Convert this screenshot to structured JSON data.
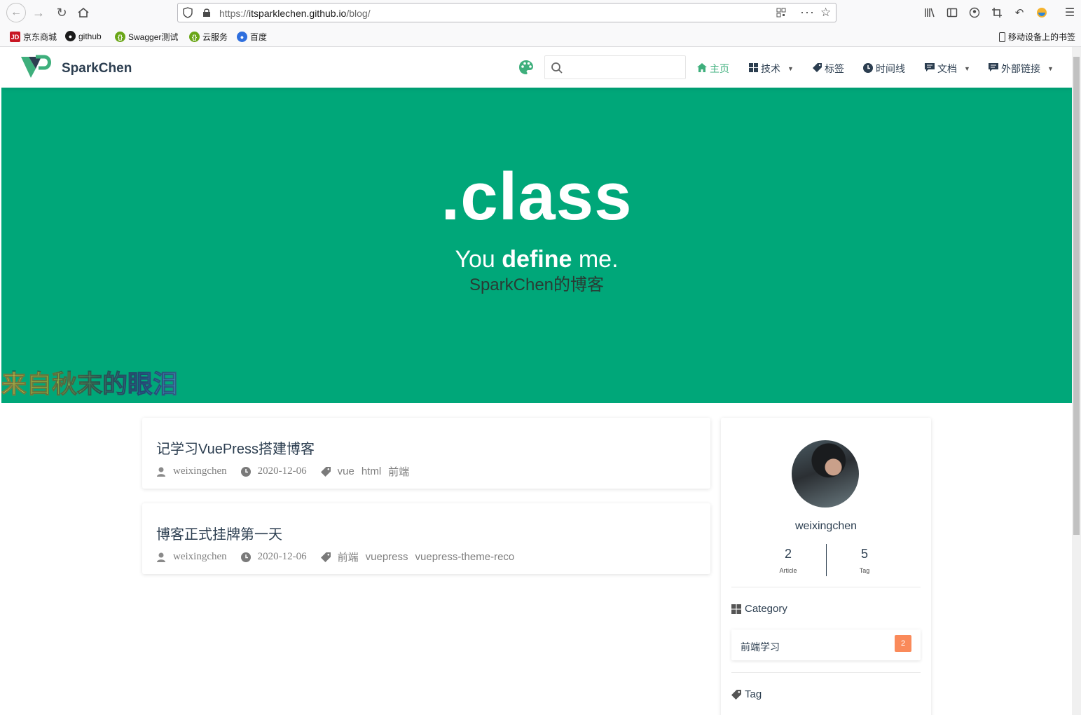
{
  "browser": {
    "url_prefix": "https://",
    "url_host": "itsparklechen.github.io",
    "url_path": "/blog/",
    "bookmarks": [
      {
        "label": "京东商城",
        "icon": "jd-icon",
        "color": "#c81623"
      },
      {
        "label": "github",
        "icon": "github-icon",
        "color": "#1b1b1b"
      },
      {
        "label": "Swagger测试",
        "icon": "swagger-icon",
        "color": "#6aa617"
      },
      {
        "label": "云服务",
        "icon": "swagger-icon",
        "color": "#6aa617"
      },
      {
        "label": "百度",
        "icon": "baidu-paw-icon",
        "color": "#2f6fde"
      }
    ],
    "mobile_bookmarks": "移动设备上的书签"
  },
  "site": {
    "name": "SparkChen",
    "accent": "#3eaf7c",
    "hero_color": "#00a779",
    "nav": [
      {
        "label": "主页",
        "icon": "home-icon",
        "active": true,
        "dropdown": false
      },
      {
        "label": "技术",
        "icon": "grid-icon",
        "active": false,
        "dropdown": true
      },
      {
        "label": "标签",
        "icon": "tag-icon",
        "active": false,
        "dropdown": false
      },
      {
        "label": "时间线",
        "icon": "clock-icon",
        "active": false,
        "dropdown": false
      },
      {
        "label": "文档",
        "icon": "message-icon",
        "active": false,
        "dropdown": true
      },
      {
        "label": "外部链接",
        "icon": "message-icon",
        "active": false,
        "dropdown": true
      }
    ]
  },
  "hero": {
    "title": ".class",
    "slogan_pre": "You ",
    "slogan_bold": "define",
    "slogan_post": " me.",
    "subtitle": "SparkChen的博客",
    "floating_text": "来自秋末的眼泪"
  },
  "posts": [
    {
      "title": "记学习VuePress搭建博客",
      "author": "weixingchen",
      "date": "2020-12-06",
      "tags": [
        "vue",
        "html",
        "前端"
      ]
    },
    {
      "title": "博客正式挂牌第一天",
      "author": "weixingchen",
      "date": "2020-12-06",
      "tags": [
        "前端",
        "vuepress",
        "vuepress-theme-reco"
      ]
    }
  ],
  "sidebar": {
    "author": "weixingchen",
    "article_count": "2",
    "article_label": "Article",
    "tag_count": "5",
    "tag_label": "Tag",
    "category_title": "Category",
    "categories": [
      {
        "name": "前端学习",
        "count": "2"
      }
    ],
    "tag_title": "Tag"
  }
}
